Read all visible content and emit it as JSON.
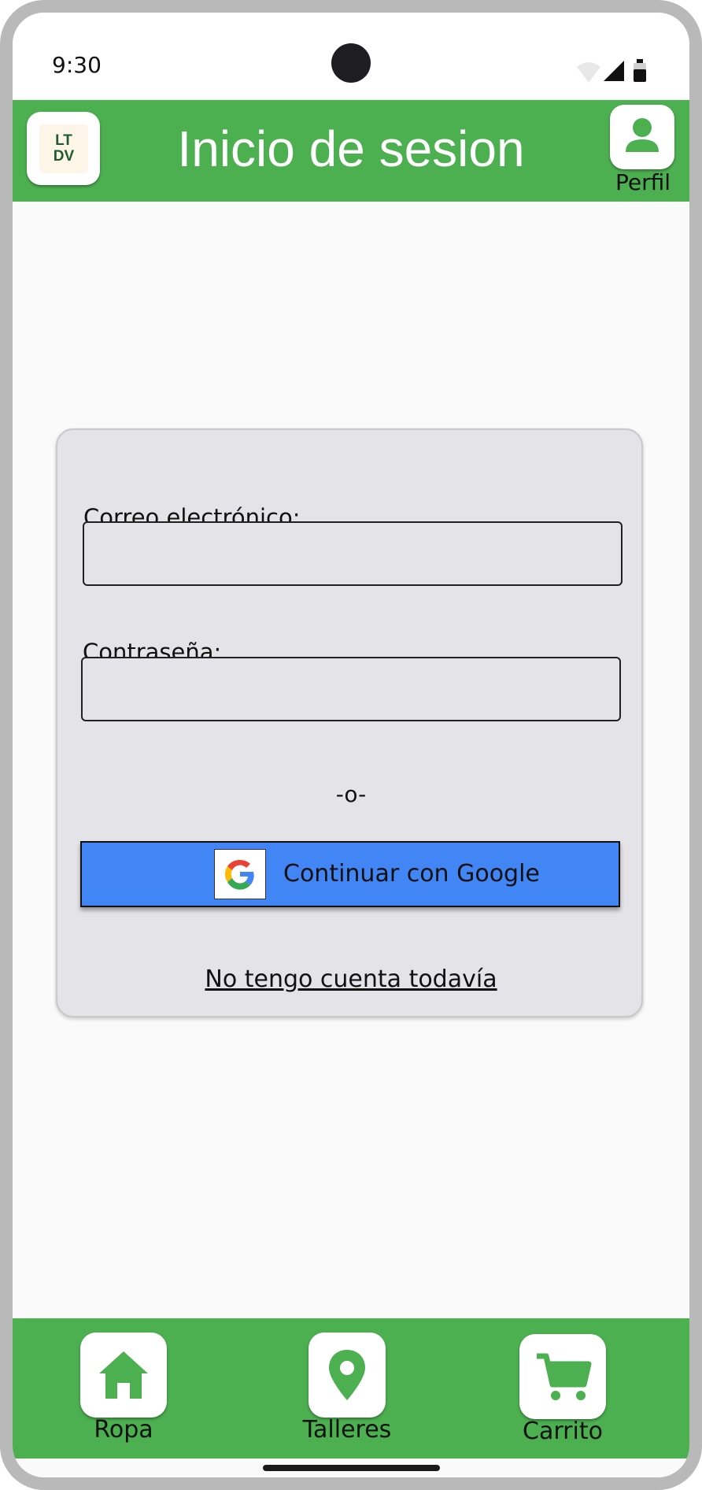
{
  "status_bar": {
    "time": "9:30",
    "icons": [
      "wifi-icon",
      "signal-icon",
      "battery-icon"
    ]
  },
  "app_bar": {
    "logo": {
      "line1": "LT",
      "line2": "DV"
    },
    "title": "Inicio de sesion",
    "profile_label": "Perfil"
  },
  "login_form": {
    "email_label": "Correo electrónico:",
    "email_value": "",
    "password_label": "Contraseña:",
    "password_value": "",
    "separator": "-o-",
    "google_button": "Continuar con Google",
    "no_account_link": "No tengo cuenta todavía"
  },
  "bottom_nav": {
    "items": [
      {
        "label": "Ropa",
        "icon": "home-icon"
      },
      {
        "label": "Talleres",
        "icon": "map-pin-icon"
      },
      {
        "label": "Carrito",
        "icon": "shopping-cart-icon"
      }
    ]
  },
  "colors": {
    "primary": "#4caf50",
    "google_blue": "#4285f4",
    "card_bg": "#e4e3e8"
  }
}
